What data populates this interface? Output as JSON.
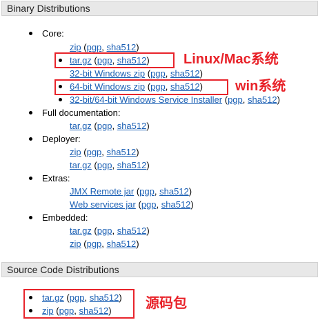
{
  "binary": {
    "header": "Binary Distributions",
    "core_label": "Core:",
    "core_items": [
      {
        "name": "zip",
        "sig": "pgp",
        "hash": "sha512"
      },
      {
        "name": "tar.gz",
        "sig": "pgp",
        "hash": "sha512"
      },
      {
        "name": "32-bit Windows zip",
        "sig": "pgp",
        "hash": "sha512"
      },
      {
        "name": "64-bit Windows zip",
        "sig": "pgp",
        "hash": "sha512"
      },
      {
        "name": "32-bit/64-bit Windows Service Installer",
        "sig": "pgp",
        "hash": "sha512"
      }
    ],
    "fulldoc_label": "Full documentation:",
    "fulldoc_items": [
      {
        "name": "tar.gz",
        "sig": "pgp",
        "hash": "sha512"
      }
    ],
    "deployer_label": "Deployer:",
    "deployer_items": [
      {
        "name": "zip",
        "sig": "pgp",
        "hash": "sha512"
      },
      {
        "name": "tar.gz",
        "sig": "pgp",
        "hash": "sha512"
      }
    ],
    "extras_label": "Extras:",
    "extras_items": [
      {
        "name": "JMX Remote jar",
        "sig": "pgp",
        "hash": "sha512"
      },
      {
        "name": "Web services jar",
        "sig": "pgp",
        "hash": "sha512"
      }
    ],
    "embedded_label": "Embedded:",
    "embedded_items": [
      {
        "name": "tar.gz",
        "sig": "pgp",
        "hash": "sha512"
      },
      {
        "name": "zip",
        "sig": "pgp",
        "hash": "sha512"
      }
    ]
  },
  "source": {
    "header": "Source Code Distributions",
    "items": [
      {
        "name": "tar.gz",
        "sig": "pgp",
        "hash": "sha512"
      },
      {
        "name": "zip",
        "sig": "pgp",
        "hash": "sha512"
      }
    ]
  },
  "annotations": {
    "linux_mac": "Linux/Mac系统",
    "win": "win系统",
    "source": "源码包"
  },
  "colors": {
    "link": "#1a5fb4",
    "annotation_red": "#e8232a",
    "header_bg": "#e8e8e8"
  }
}
